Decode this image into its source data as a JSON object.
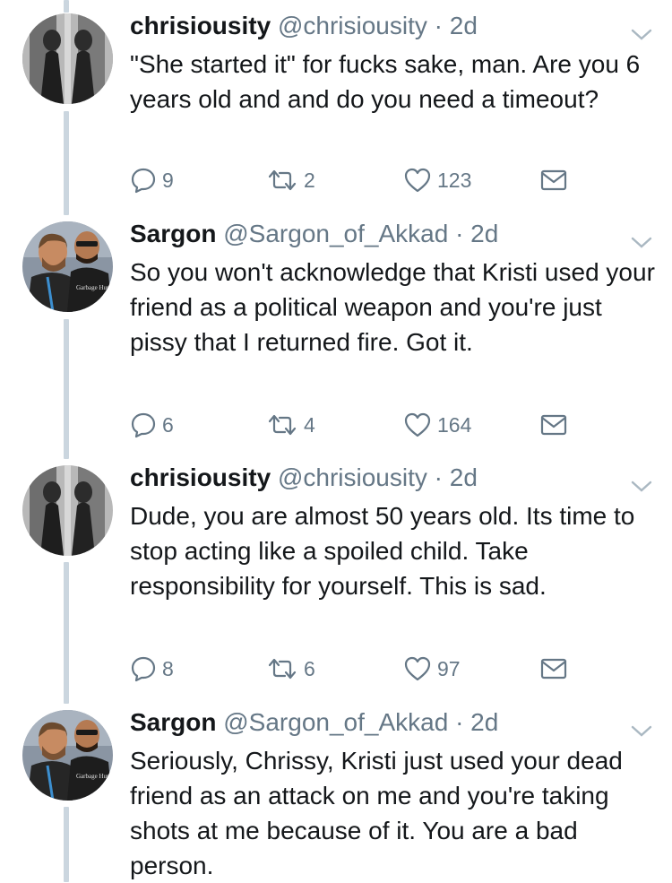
{
  "tweets": [
    {
      "name": "chrisiousity",
      "handle": "@chrisiousity",
      "separator": "·",
      "time": "2d",
      "text": "\"She started it\" for fucks sake, man. Are you 6 years old and and do you need a timeout?",
      "replies": "9",
      "retweets": "2",
      "likes": "123",
      "avatar": "chrisiousity"
    },
    {
      "name": "Sargon",
      "handle": "@Sargon_of_Akkad",
      "separator": "·",
      "time": "2d",
      "text": "So you won't acknowledge that Kristi used your friend as a political weapon and you're just pissy that I returned fire. Got it.",
      "replies": "6",
      "retweets": "4",
      "likes": "164",
      "avatar": "sargon"
    },
    {
      "name": "chrisiousity",
      "handle": "@chrisiousity",
      "separator": "·",
      "time": "2d",
      "text": "Dude, you are almost 50 years old. Its time to stop acting like a spoiled child. Take responsibility for yourself. This is sad.",
      "replies": "8",
      "retweets": "6",
      "likes": "97",
      "avatar": "chrisiousity"
    },
    {
      "name": "Sargon",
      "handle": "@Sargon_of_Akkad",
      "separator": "·",
      "time": "2d",
      "text": "Seriously, Chrissy, Kristi just used your dead friend as an attack on me and you're taking shots at me because of it. You are a bad person.",
      "avatar": "sargon",
      "shirt_text": "Garbage Human"
    }
  ],
  "icons": {
    "reply": "reply-icon",
    "retweet": "retweet-icon",
    "like": "heart-icon",
    "dm": "envelope-icon",
    "menu": "chevron-down-icon"
  },
  "colors": {
    "text": "#14171a",
    "secondary": "#657786",
    "thread_line": "#cbd6df"
  }
}
